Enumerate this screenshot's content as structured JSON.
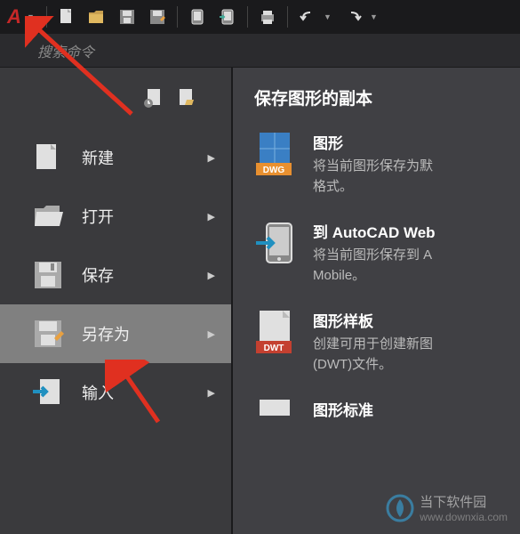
{
  "search": {
    "placeholder": "搜索命令"
  },
  "menu": {
    "new": "新建",
    "open": "打开",
    "save": "保存",
    "saveAs": "另存为",
    "import": "输入"
  },
  "panel": {
    "title": "保存图形的副本",
    "options": {
      "dwg": {
        "title": "图形",
        "desc": "将当前图形保存为默",
        "desc2": "格式。",
        "badge": "DWG"
      },
      "web": {
        "title": "到 AutoCAD Web",
        "desc": "将当前图形保存到 A",
        "desc2": "Mobile。"
      },
      "dwt": {
        "title": "图形样板",
        "desc": "创建可用于创建新图",
        "desc2": "(DWT)文件。",
        "badge": "DWT"
      },
      "dws": {
        "title": "图形标准"
      }
    }
  },
  "watermark": {
    "cn": "当下软件园",
    "url": "www.downxia.com"
  }
}
